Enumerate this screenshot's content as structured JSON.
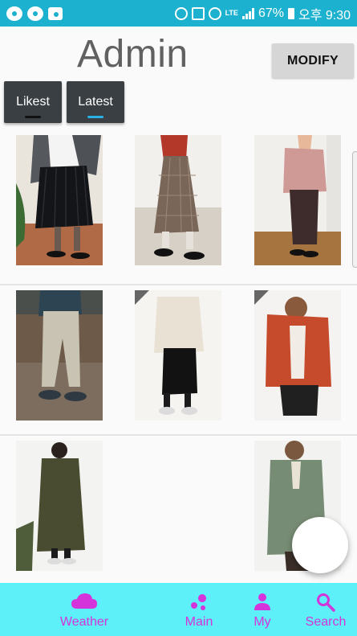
{
  "status_bar": {
    "battery": "67%",
    "time": "오후 9:30",
    "network": "LTE",
    "notification_icons": [
      "circle-app-icon",
      "talk-icon",
      "gallery-icon"
    ],
    "system_icons": [
      "data-saver-icon",
      "mute-icon",
      "alarm-icon",
      "lte-icon",
      "signal-icon",
      "battery-icon"
    ]
  },
  "header": {
    "title": "Admin",
    "modify_label": "MODIFY"
  },
  "tabs": [
    {
      "label": "Likest",
      "active": false
    },
    {
      "label": "Latest",
      "active": true
    }
  ],
  "accent_colors": {
    "status_bar": "#1cb1cf",
    "bottom_nav": "#5ef0f9",
    "nav_icon": "#d434d9",
    "tab_indicator": "#29b1e4"
  },
  "grid": {
    "columns": 3,
    "items": [
      {
        "row": 1,
        "col": 1,
        "subject": "pleated-skirt-outfit"
      },
      {
        "row": 1,
        "col": 2,
        "subject": "check-skirt-outfit"
      },
      {
        "row": 1,
        "col": 3,
        "subject": "pink-knit-outfit"
      },
      {
        "row": 2,
        "col": 1,
        "subject": "chino-pants-outfit"
      },
      {
        "row": 2,
        "col": 2,
        "subject": "fleece-jacket-outfit"
      },
      {
        "row": 2,
        "col": 3,
        "subject": "orange-hoodie-outfit"
      },
      {
        "row": 3,
        "col": 1,
        "subject": "khaki-coat-outfit"
      },
      {
        "row": 3,
        "col": 3,
        "subject": "green-coat-outfit"
      }
    ]
  },
  "bottom_nav": [
    {
      "label": "Weather",
      "icon": "cloud-icon"
    },
    {
      "label": "Main",
      "icon": "bubbles-icon"
    },
    {
      "label": "My",
      "icon": "person-icon"
    },
    {
      "label": "Search",
      "icon": "search-icon"
    }
  ]
}
